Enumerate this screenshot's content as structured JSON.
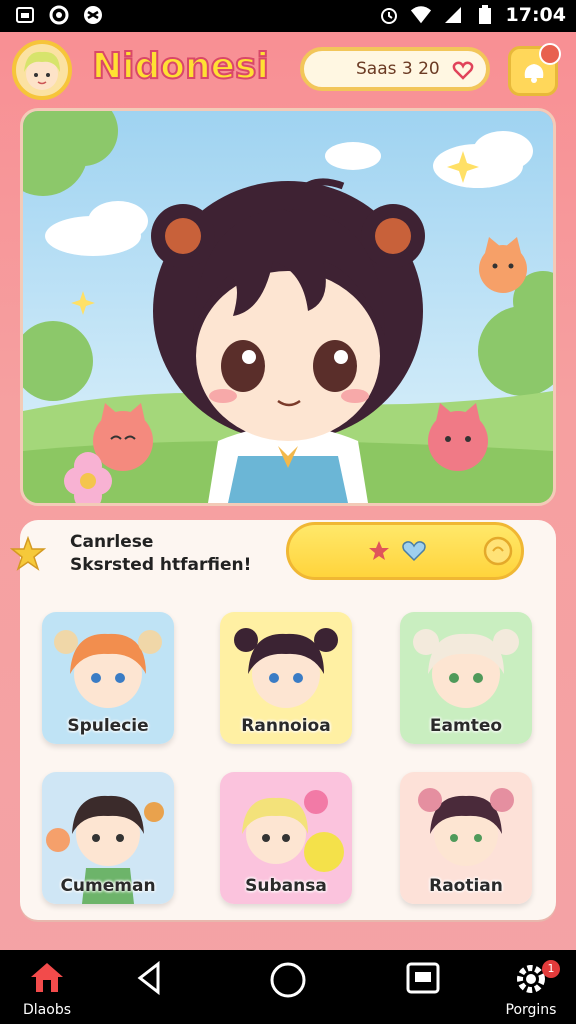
{
  "status_bar": {
    "time": "17:04",
    "icons": [
      "gallery-icon",
      "sync-icon",
      "app-icon",
      "alarm-icon",
      "wifi-icon",
      "signal-icon",
      "battery-icon"
    ]
  },
  "header": {
    "title": "Nidonesi",
    "score_label": "Saas 3 20",
    "heart_icon": "heart-icon",
    "notification_icon": "notification-icon"
  },
  "hero": {
    "description_icon": "character-scene"
  },
  "quest": {
    "line1": "Canrlese",
    "line2": "Sksrsted htfarfien!",
    "reward_icons": [
      "star-icon",
      "heart-icon",
      "coin-icon"
    ]
  },
  "characters": [
    {
      "name": "Spulecie",
      "bg": "#bfe3f5",
      "hair": "#f28e4e"
    },
    {
      "name": "Rannoioa",
      "bg": "#fff0a3",
      "hair": "#3b2333"
    },
    {
      "name": "Eamteo",
      "bg": "#c9eec0",
      "hair": "#f3eadc"
    },
    {
      "name": "Cumeman",
      "bg": "#cfe6f5",
      "hair": "#3b2b2b"
    },
    {
      "name": "Subansa",
      "bg": "#fbc3dd",
      "hair": "#f3e27a"
    },
    {
      "name": "Raotian",
      "bg": "#fde1d8",
      "hair": "#4a2a3a"
    }
  ],
  "nav": {
    "left_label": "Dlaobs",
    "right_label": "Porgins",
    "right_badge": "1"
  },
  "colors": {
    "background": "#f88e93",
    "title_fill": "#ffe033",
    "title_stroke": "#d94869",
    "button_yellow": "#ffd43c"
  }
}
